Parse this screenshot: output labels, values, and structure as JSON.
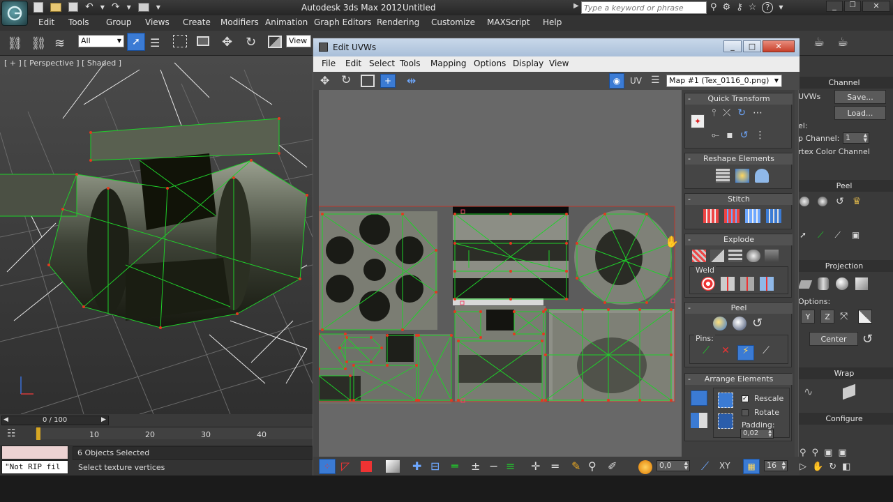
{
  "app": {
    "title": "Autodesk 3ds Max  2012",
    "file": "Untitled"
  },
  "search": {
    "placeholder": "Type a keyword or phrase"
  },
  "menu": [
    "Edit",
    "Tools",
    "Group",
    "Views",
    "Create",
    "Modifiers",
    "Animation",
    "Graph Editors",
    "Rendering",
    "Customize",
    "MAXScript",
    "Help"
  ],
  "toolbar": {
    "selection_filter": "All",
    "ref_coord": "View"
  },
  "viewport": {
    "label": "[ + ] [ Perspective ] [ Shaded ]"
  },
  "timeline": {
    "frame_readout": "0 / 100",
    "ticks": [
      "10",
      "20",
      "30",
      "40"
    ]
  },
  "status": {
    "objects_selected": "6 Objects Selected",
    "prompt": "Select texture vertices",
    "script_listener": "\"Not RIP fil"
  },
  "uvw": {
    "title": "Edit UVWs",
    "menu": [
      "File",
      "Edit",
      "Select",
      "Tools",
      "Mapping",
      "Options",
      "Display",
      "View"
    ],
    "uv_label": "UV",
    "map_select": "Map #1 (Tex_0116_0.png)",
    "rollouts": {
      "quick_transform": "Quick Transform",
      "reshape": "Reshape Elements",
      "stitch": "Stitch",
      "explode": "Explode",
      "weld": "Weld",
      "peel": "Peel",
      "pins": "Pins:",
      "arrange": "Arrange Elements",
      "rescale": "Rescale",
      "rotate": "Rotate",
      "padding_label": "Padding:",
      "padding_value": "0,02"
    },
    "bottom": {
      "value_a": "0,0",
      "xy": "XY",
      "value_b": "16"
    }
  },
  "right_panel": {
    "channel": "Channel",
    "uvws": "UVWs",
    "save": "Save...",
    "load": "Load...",
    "el": "el:",
    "map_channel_label": "p Channel:",
    "map_channel_value": "1",
    "vertex_color_channel": "rtex Color Channel",
    "peel": "Peel",
    "projection": "Projection",
    "options": "Options:",
    "center": "Center",
    "wrap": "Wrap",
    "configure": "Configure",
    "y": "Y",
    "z": "Z"
  },
  "colors": {
    "accent": "#3b7bd4",
    "uv_edge": "#1fd12a",
    "uv_vertex": "#e23a1f"
  }
}
